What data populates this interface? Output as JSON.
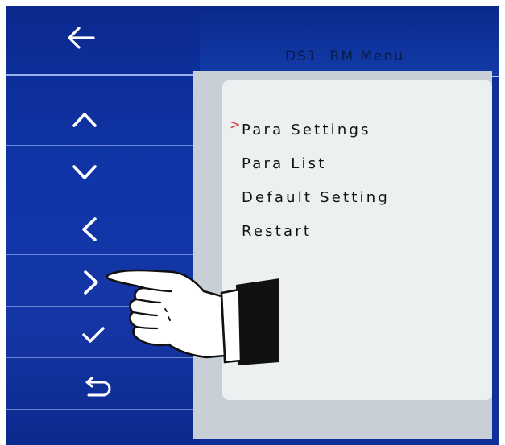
{
  "header": {
    "title": "DS1  RM Menu"
  },
  "nav": {
    "back": "arrow-left-icon",
    "buttons": [
      "chevron-up-icon",
      "chevron-down-icon",
      "chevron-left-icon",
      "chevron-right-icon",
      "check-icon",
      "return-icon"
    ]
  },
  "menu": {
    "cursor": ">",
    "selected_index": 0,
    "items": [
      {
        "label": "Para Settings"
      },
      {
        "label": "Para List"
      },
      {
        "label": "Default Setting"
      },
      {
        "label": "Restart"
      }
    ]
  },
  "colors": {
    "nav_blue": "#0f35a8",
    "panel": "#edf0f0",
    "cursor": "#d0302a",
    "separator": "#b8c8f0"
  }
}
